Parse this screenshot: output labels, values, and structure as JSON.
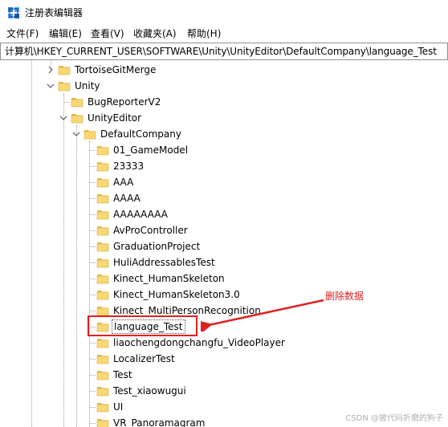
{
  "window": {
    "title": "注册表编辑器",
    "app_icon": "registry-editor-icon"
  },
  "menu": {
    "items": [
      "文件(F)",
      "编辑(E)",
      "查看(V)",
      "收藏夹(A)",
      "帮助(H)"
    ]
  },
  "address": {
    "path": "计算机\\HKEY_CURRENT_USER\\SOFTWARE\\Unity\\UnityEditor\\DefaultCompany\\language_Test"
  },
  "tree": {
    "nodes": [
      {
        "label": "TortoiseGitMerge",
        "depth": 0,
        "state": "collapsed"
      },
      {
        "label": "Unity",
        "depth": 0,
        "state": "expanded"
      },
      {
        "label": "BugReporterV2",
        "depth": 1,
        "state": "leaf"
      },
      {
        "label": "UnityEditor",
        "depth": 1,
        "state": "expanded"
      },
      {
        "label": "DefaultCompany",
        "depth": 2,
        "state": "expanded"
      },
      {
        "label": "01_GameModel",
        "depth": 3,
        "state": "leaf"
      },
      {
        "label": "23333",
        "depth": 3,
        "state": "leaf"
      },
      {
        "label": "AAA",
        "depth": 3,
        "state": "leaf"
      },
      {
        "label": "AAAA",
        "depth": 3,
        "state": "leaf"
      },
      {
        "label": "AAAAAAAA",
        "depth": 3,
        "state": "leaf"
      },
      {
        "label": "AvProController",
        "depth": 3,
        "state": "leaf"
      },
      {
        "label": "GraduationProject",
        "depth": 3,
        "state": "leaf"
      },
      {
        "label": "HuliAddressablesTest",
        "depth": 3,
        "state": "leaf"
      },
      {
        "label": "Kinect_HumanSkeleton",
        "depth": 3,
        "state": "leaf"
      },
      {
        "label": "Kinect_HumanSkeleton3.0",
        "depth": 3,
        "state": "leaf"
      },
      {
        "label": "Kinect_MultiPersonRecognition",
        "depth": 3,
        "state": "leaf"
      },
      {
        "label": "language_Test",
        "depth": 3,
        "state": "leaf",
        "selected": true
      },
      {
        "label": "liaochengdongchangfu_VideoPlayer",
        "depth": 3,
        "state": "leaf"
      },
      {
        "label": "LocalizerTest",
        "depth": 3,
        "state": "leaf"
      },
      {
        "label": "Test",
        "depth": 3,
        "state": "leaf"
      },
      {
        "label": "Test_xiaowugui",
        "depth": 3,
        "state": "leaf"
      },
      {
        "label": "UI",
        "depth": 3,
        "state": "leaf"
      },
      {
        "label": "VR_Panoramagram",
        "depth": 3,
        "state": "leaf"
      }
    ]
  },
  "annotation": {
    "text": "删除数据",
    "color": "#e02020"
  },
  "watermark": {
    "text": "CSDN @披代码折磨的狗子"
  },
  "colors": {
    "folder_fill": "#f8d775",
    "folder_tab": "#e8b84a",
    "chevron": "#6b6b6b"
  }
}
